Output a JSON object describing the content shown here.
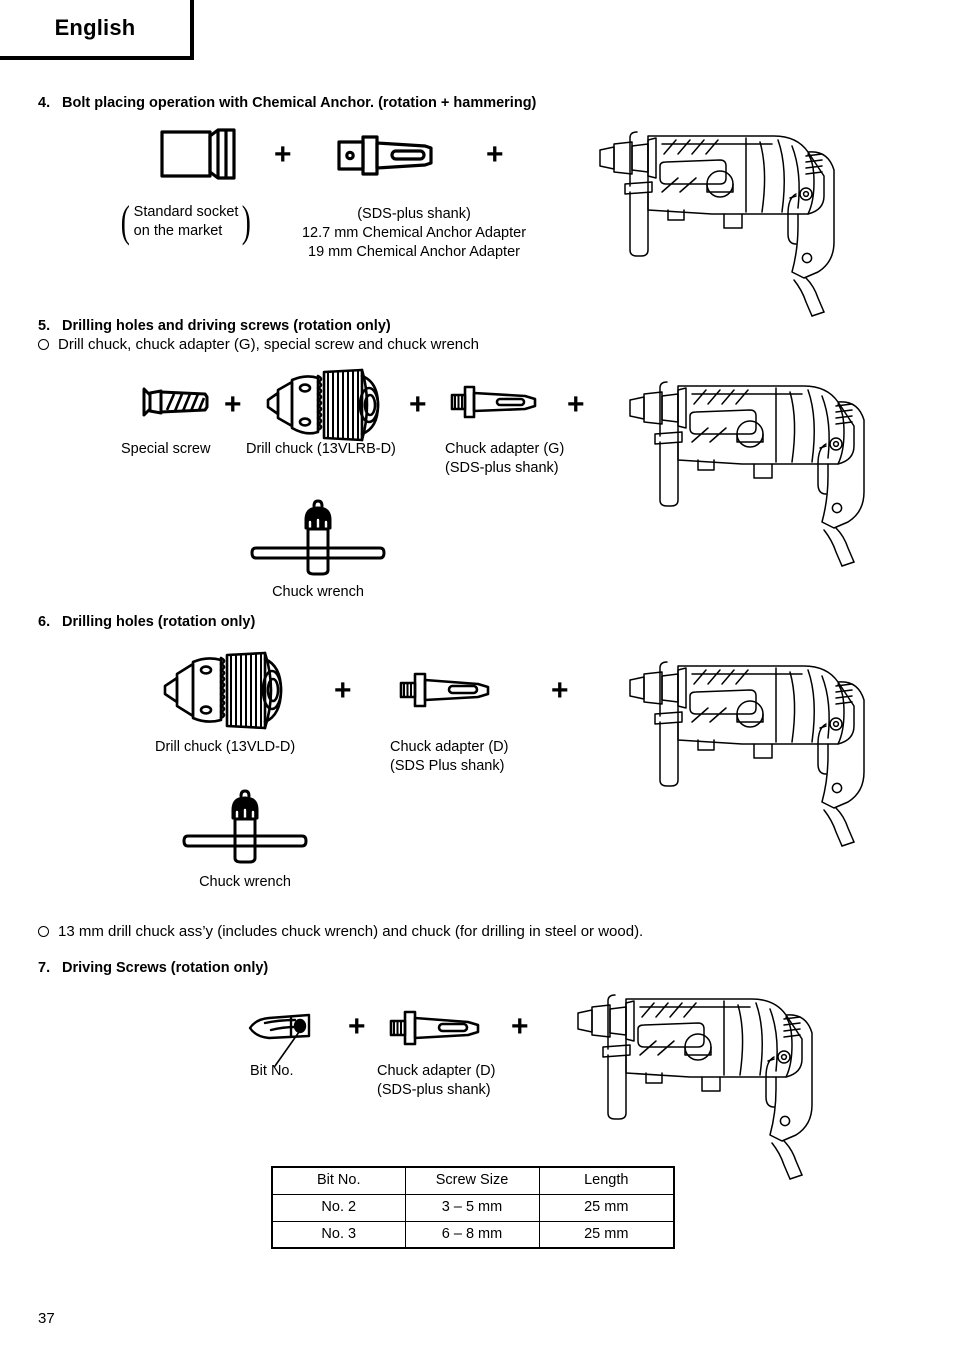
{
  "header": {
    "language": "English"
  },
  "page": {
    "number": "37"
  },
  "sections": [
    {
      "number": "4.",
      "title": "Bolt placing operation with Chemical Anchor. (rotation + hammering)",
      "captions": {
        "socket_line1": "Standard socket",
        "socket_line2": "on the market",
        "adapter_line1": "(SDS-plus shank)",
        "adapter_line2": "12.7 mm Chemical Anchor Adapter",
        "adapter_line3": "19 mm Chemical Anchor Adapter"
      },
      "plus1": "+",
      "plus2": "+"
    },
    {
      "number": "5.",
      "title": "Drilling holes and driving screws (rotation only)",
      "bullet": "Drill chuck, chuck adapter (G), special screw and chuck wrench",
      "captions": {
        "special_screw": "Special screw",
        "drill_chuck": "Drill chuck (13VLRB-D)",
        "chuck_adapter_1": "Chuck adapter (G)",
        "chuck_adapter_2": "(SDS-plus shank)",
        "chuck_wrench": "Chuck wrench"
      },
      "plus1": "+",
      "plus2": "+",
      "plus3": "+"
    },
    {
      "number": "6.",
      "title": "Drilling holes (rotation only)",
      "captions": {
        "drill_chuck": "Drill chuck (13VLD-D)",
        "chuck_adapter_1": "Chuck adapter (D)",
        "chuck_adapter_2": "(SDS Plus shank)",
        "chuck_wrench": "Chuck wrench"
      },
      "plus1": "+",
      "plus2": "+",
      "bullet_after": "13 mm drill chuck ass’y (includes chuck wrench) and chuck (for drilling in steel or wood)."
    },
    {
      "number": "7.",
      "title": "Driving Screws (rotation only)",
      "captions": {
        "bit_no": "Bit No.",
        "chuck_adapter_1": "Chuck adapter (D)",
        "chuck_adapter_2": "(SDS-plus shank)"
      },
      "plus1": "+",
      "plus2": "+"
    }
  ],
  "table": {
    "headers": [
      "Bit No.",
      "Screw Size",
      "Length"
    ],
    "rows": [
      [
        "No. 2",
        "3 – 5 mm",
        "25 mm"
      ],
      [
        "No. 3",
        "6 – 8 mm",
        "25 mm"
      ]
    ]
  },
  "colors": {
    "ink": "#000000",
    "paper": "#ffffff"
  }
}
